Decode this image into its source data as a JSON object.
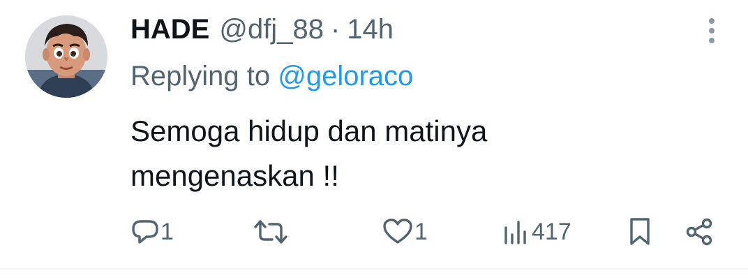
{
  "tweet": {
    "author_name": "HADE",
    "handle": "@dfj_88",
    "separator": "·",
    "time": "14h",
    "replying_prefix": "Replying to",
    "replying_to": "@geloraco",
    "text_lines": [
      "Semoga hidup dan matinya",
      "mengenaskan !!"
    ]
  },
  "actions": {
    "reply_count": "1",
    "like_count": "1",
    "views_count": "417"
  },
  "icons": {
    "more": "more-vertical-icon",
    "reply": "comment-bubble-icon",
    "retweet": "retweet-icon",
    "like": "heart-icon",
    "views": "bar-chart-icon",
    "bookmark": "bookmark-icon",
    "share": "share-icon"
  },
  "colors": {
    "text_primary": "#0f1419",
    "text_secondary": "#536471",
    "link": "#1d9bf0",
    "divider": "#eff3f4"
  }
}
